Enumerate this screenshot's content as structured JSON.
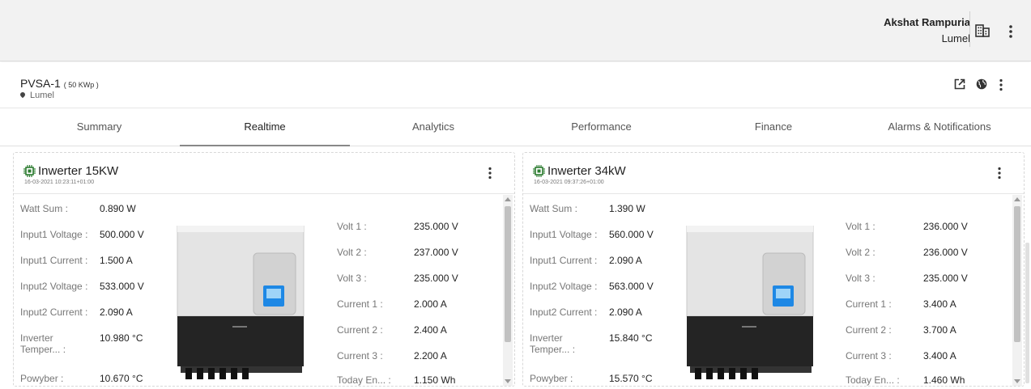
{
  "header": {
    "user_name": "Akshat Rampuria",
    "org": "Lumel"
  },
  "site": {
    "name": "PVSA-1",
    "capacity": "( 50 KWp )",
    "location": "Lumel"
  },
  "tabs": [
    "Summary",
    "Realtime",
    "Analytics",
    "Performance",
    "Finance",
    "Alarms & Notifications"
  ],
  "active_tab": "Realtime",
  "cards": [
    {
      "title": "Inwerter 15KW",
      "timestamp": "16-03-2021 10:23:11+01:00",
      "left": [
        {
          "label": "Watt Sum :",
          "value": "0.890 W"
        },
        {
          "label": "Input1 Voltage :",
          "value": "500.000 V"
        },
        {
          "label": "Input1 Current :",
          "value": "1.500 A"
        },
        {
          "label": "Input2 Voltage :",
          "value": "533.000 V"
        },
        {
          "label": "Input2 Current :",
          "value": "2.090 A"
        },
        {
          "label": "Inverter Temper... :",
          "value": "10.980 °C"
        },
        {
          "label": "Powyber :",
          "value": "10.670 °C"
        }
      ],
      "right": [
        {
          "label": "Volt 1 :",
          "value": "235.000 V"
        },
        {
          "label": "Volt 2 :",
          "value": "237.000 V"
        },
        {
          "label": "Volt 3 :",
          "value": "235.000 V"
        },
        {
          "label": "Current 1 :",
          "value": "2.000 A"
        },
        {
          "label": "Current 2 :",
          "value": "2.400 A"
        },
        {
          "label": "Current 3 :",
          "value": "2.200 A"
        },
        {
          "label": "Today En... :",
          "value": "1.150 Wh"
        }
      ]
    },
    {
      "title": "Inwerter 34kW",
      "timestamp": "16-03-2021 09:37:26+01:00",
      "left": [
        {
          "label": "Watt Sum :",
          "value": "1.390 W"
        },
        {
          "label": "Input1 Voltage :",
          "value": "560.000 V"
        },
        {
          "label": "Input1 Current :",
          "value": "2.090 A"
        },
        {
          "label": "Input2 Voltage :",
          "value": "563.000 V"
        },
        {
          "label": "Input2 Current :",
          "value": "2.090 A"
        },
        {
          "label": "Inverter Temper... :",
          "value": "15.840 °C"
        },
        {
          "label": "Powyber :",
          "value": "15.570 °C"
        }
      ],
      "right": [
        {
          "label": "Volt 1 :",
          "value": "236.000 V"
        },
        {
          "label": "Volt 2 :",
          "value": "236.000 V"
        },
        {
          "label": "Volt 3 :",
          "value": "235.000 V"
        },
        {
          "label": "Current 1 :",
          "value": "3.400 A"
        },
        {
          "label": "Current 2 :",
          "value": "3.700 A"
        },
        {
          "label": "Current 3 :",
          "value": "3.400 A"
        },
        {
          "label": "Today En... :",
          "value": "1.460 Wh"
        }
      ]
    }
  ],
  "icons": {
    "building": "building-icon",
    "kebab": "more-vert-icon",
    "open_external": "open-in-new-icon",
    "globe": "globe-icon",
    "location": "location-pin-icon",
    "chip": "inverter-chip-icon"
  },
  "colors": {
    "header_bg": "#f2f2f2",
    "active_tab_underline": "#888888",
    "chip_color": "#2e7d32",
    "display_blue": "#1e88e5"
  }
}
